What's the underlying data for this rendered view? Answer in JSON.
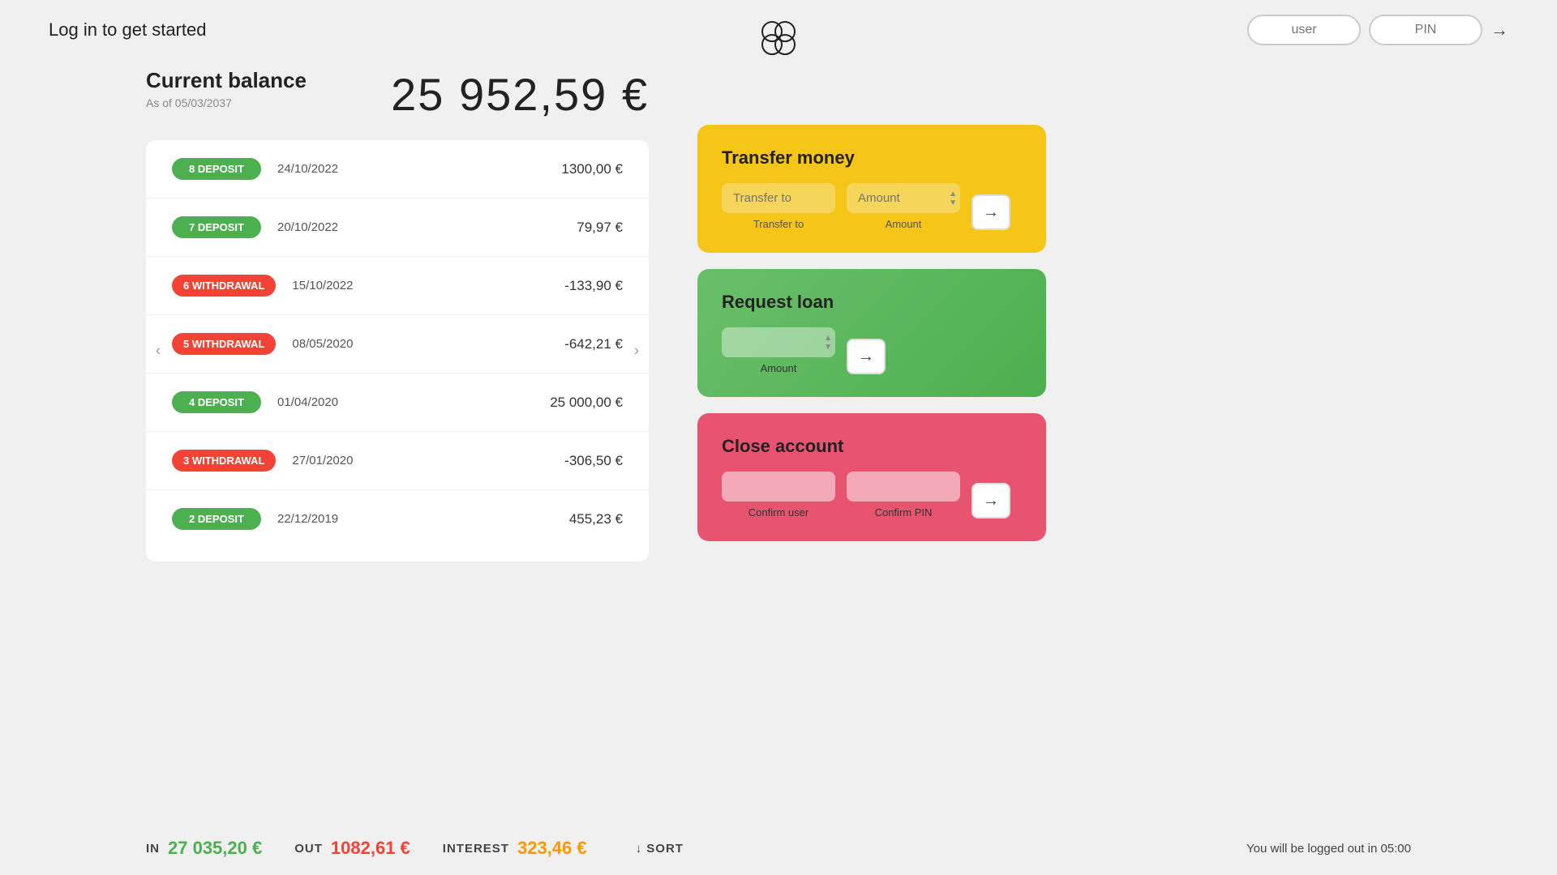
{
  "header": {
    "title": "Log in to get started",
    "user_placeholder": "user",
    "pin_placeholder": "PIN",
    "arrow": "→"
  },
  "balance": {
    "label": "Current balance",
    "date": "As of 05/03/2037",
    "amount": "25 952,59 €"
  },
  "transactions": [
    {
      "id": "8",
      "type": "DEPOSIT",
      "date": "24/10/2022",
      "amount": "1300,00 €",
      "is_deposit": true
    },
    {
      "id": "7",
      "type": "DEPOSIT",
      "date": "20/10/2022",
      "amount": "79,97 €",
      "is_deposit": true
    },
    {
      "id": "6",
      "type": "WITHDRAWAL",
      "date": "15/10/2022",
      "amount": "-133,90 €",
      "is_deposit": false
    },
    {
      "id": "5",
      "type": "WITHDRAWAL",
      "date": "08/05/2020",
      "amount": "-642,21 €",
      "is_deposit": false
    },
    {
      "id": "4",
      "type": "DEPOSIT",
      "date": "01/04/2020",
      "amount": "25 000,00 €",
      "is_deposit": true
    },
    {
      "id": "3",
      "type": "WITHDRAWAL",
      "date": "27/01/2020",
      "amount": "-306,50 €",
      "is_deposit": false
    },
    {
      "id": "2",
      "type": "DEPOSIT",
      "date": "22/12/2019",
      "amount": "455,23 €",
      "is_deposit": true
    }
  ],
  "footer": {
    "in_label": "IN",
    "in_value": "27 035,20 €",
    "out_label": "OUT",
    "out_value": "1082,61 €",
    "interest_label": "INTEREST",
    "interest_value": "323,46 €",
    "sort_label": "↓ SORT",
    "logout_text": "You will be logged out in 05:00"
  },
  "transfer": {
    "title": "Transfer money",
    "transfer_to_placeholder": "Transfer to",
    "amount_placeholder": "Amount",
    "transfer_to_label": "Transfer to",
    "amount_label": "Amount",
    "arrow": "→"
  },
  "loan": {
    "title": "Request loan",
    "amount_placeholder": "",
    "amount_label": "Amount",
    "arrow": "→"
  },
  "close": {
    "title": "Close account",
    "confirm_user_placeholder": "",
    "confirm_pin_placeholder": "",
    "confirm_user_label": "Confirm user",
    "confirm_pin_label": "Confirm PIN",
    "arrow": "→"
  }
}
